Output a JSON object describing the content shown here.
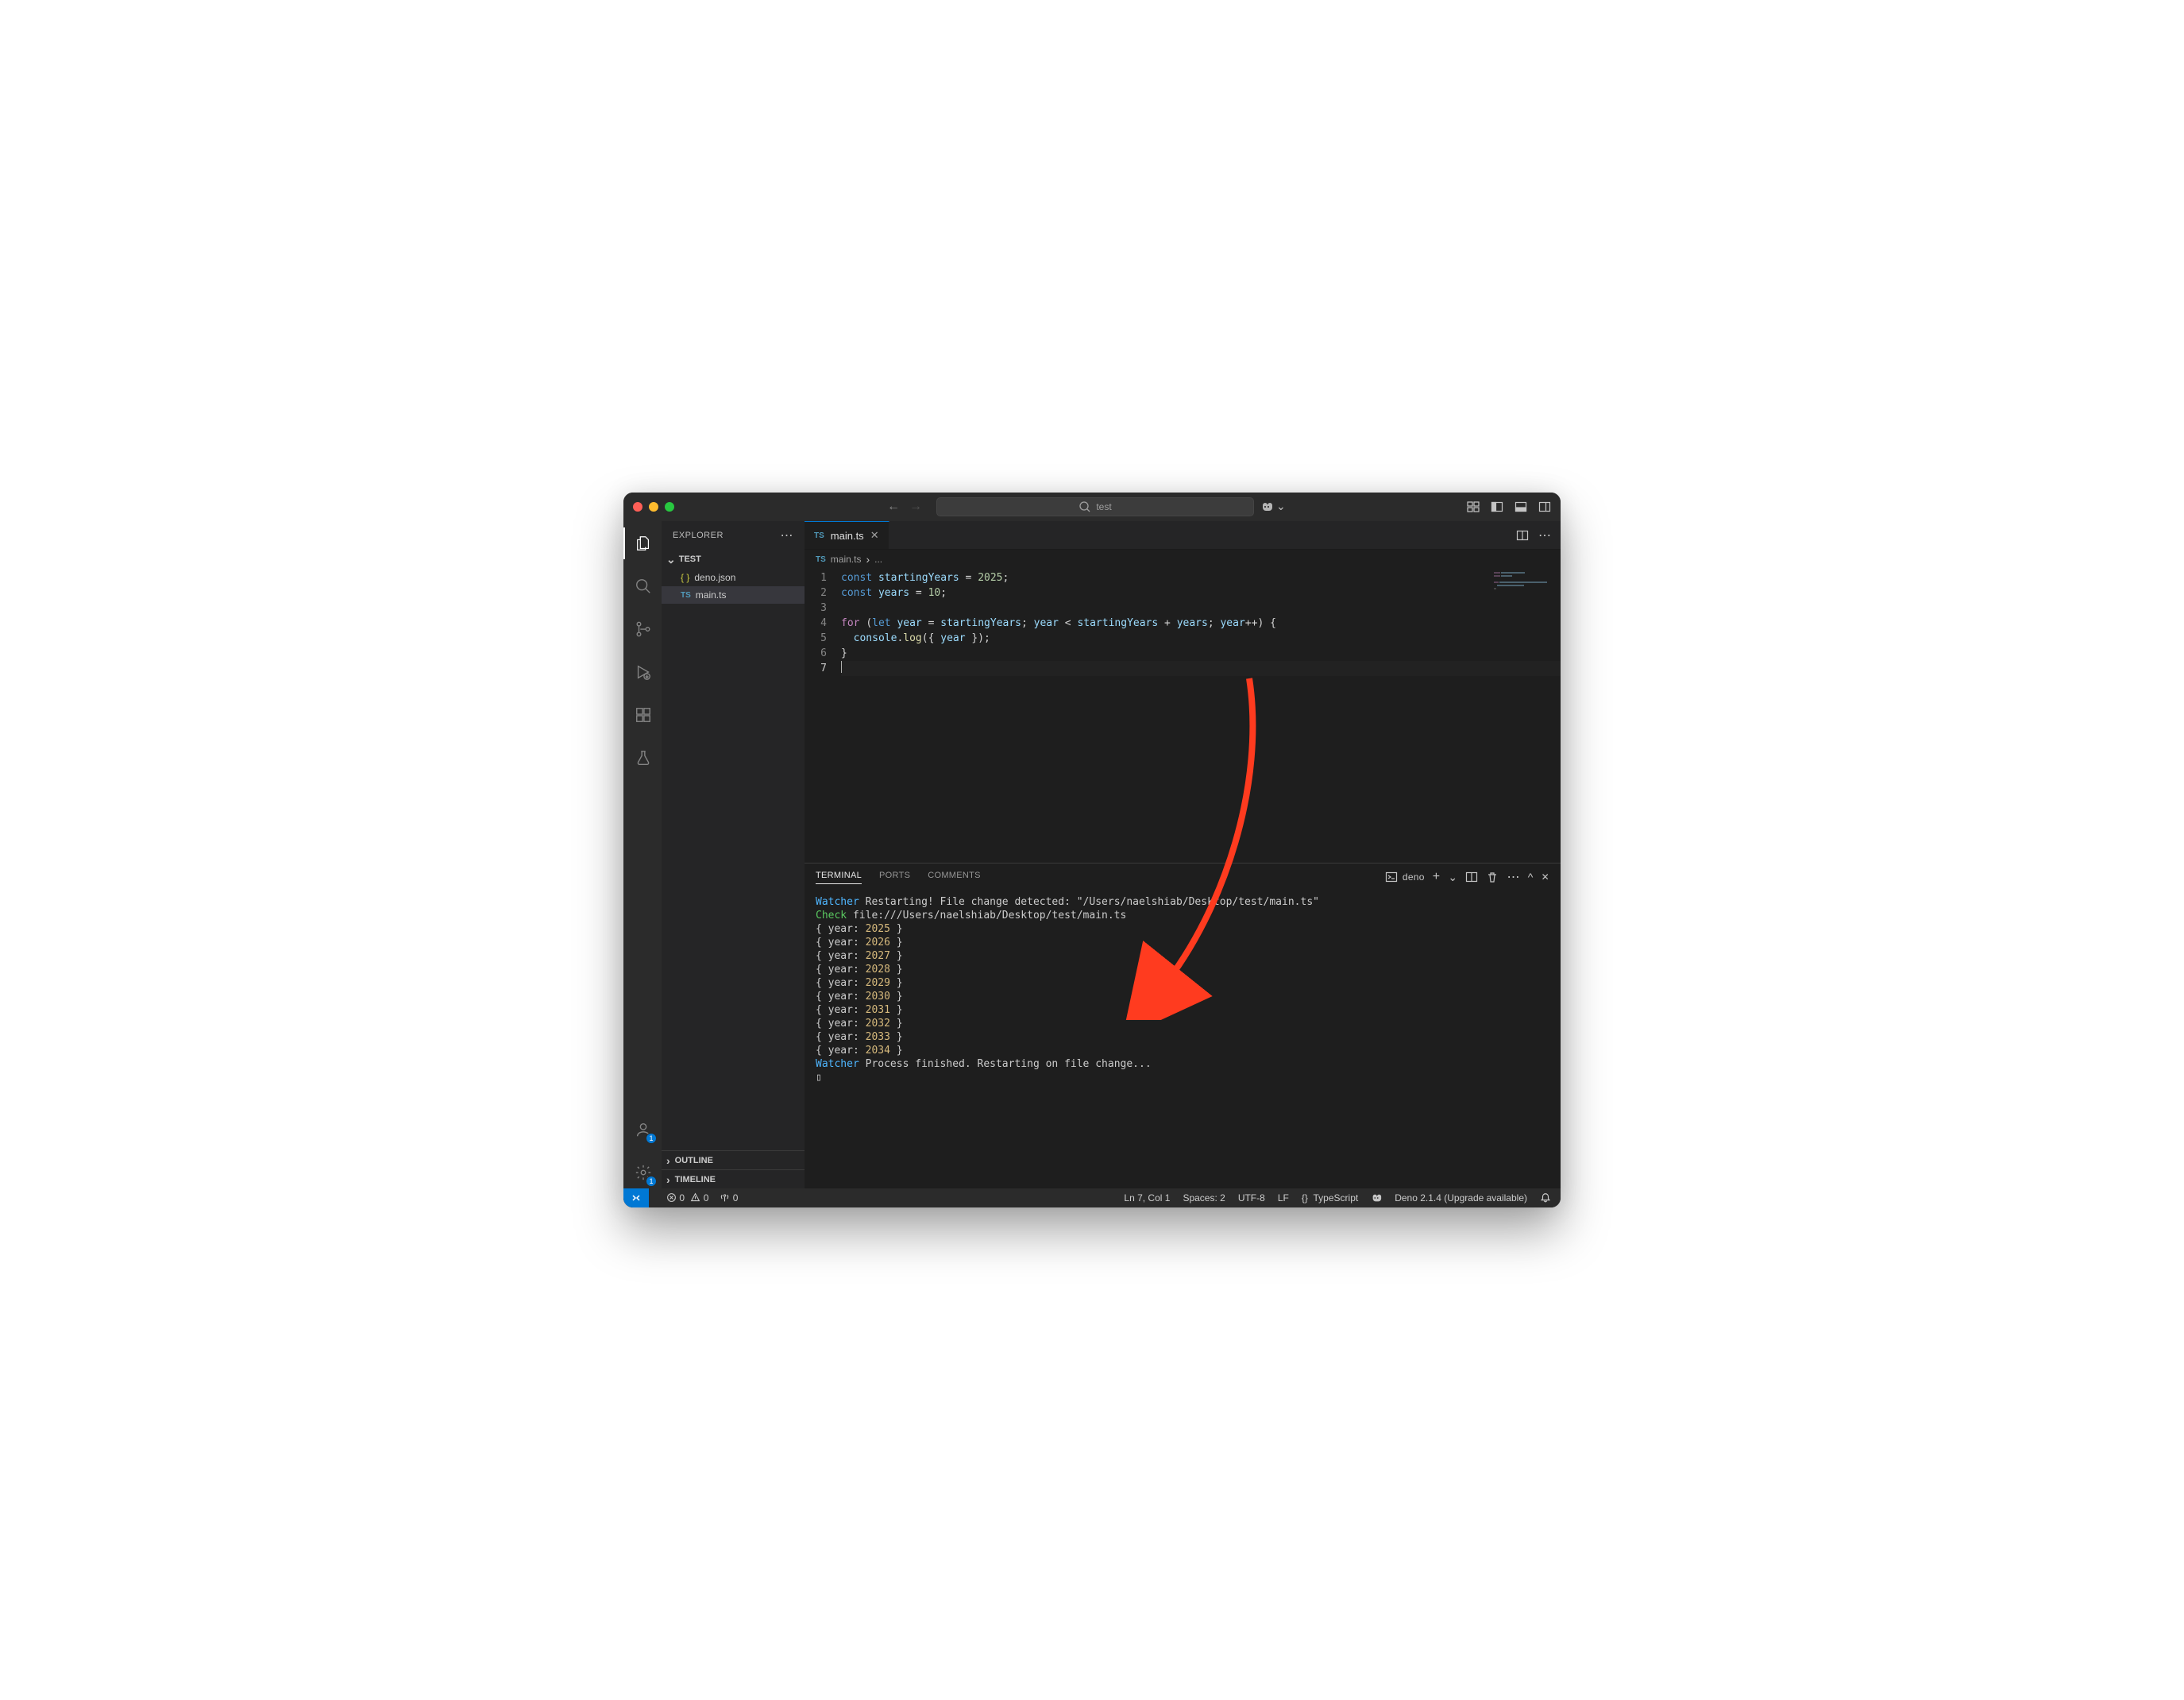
{
  "titlebar": {
    "search_text": "test"
  },
  "explorer": {
    "title": "EXPLORER",
    "root": "TEST",
    "items": [
      {
        "icon": "json",
        "label": "deno.json"
      },
      {
        "icon": "ts",
        "label": "main.ts",
        "selected": true
      }
    ],
    "outline": "OUTLINE",
    "timeline": "TIMELINE"
  },
  "tab": {
    "icon": "TS",
    "label": "main.ts"
  },
  "breadcrumb": {
    "icon": "TS",
    "file": "main.ts",
    "rest": "..."
  },
  "code": {
    "lines": [
      {
        "n": 1,
        "tokens": [
          {
            "t": "const ",
            "c": "kw2"
          },
          {
            "t": "startingYears",
            "c": "var"
          },
          {
            "t": " = ",
            "c": "op"
          },
          {
            "t": "2025",
            "c": "num"
          },
          {
            "t": ";",
            "c": "pun"
          }
        ]
      },
      {
        "n": 2,
        "tokens": [
          {
            "t": "const ",
            "c": "kw2"
          },
          {
            "t": "years",
            "c": "var"
          },
          {
            "t": " = ",
            "c": "op"
          },
          {
            "t": "10",
            "c": "num"
          },
          {
            "t": ";",
            "c": "pun"
          }
        ]
      },
      {
        "n": 3,
        "tokens": []
      },
      {
        "n": 4,
        "tokens": [
          {
            "t": "for ",
            "c": "kw"
          },
          {
            "t": "(",
            "c": "pun"
          },
          {
            "t": "let ",
            "c": "kw2"
          },
          {
            "t": "year",
            "c": "var"
          },
          {
            "t": " = ",
            "c": "op"
          },
          {
            "t": "startingYears",
            "c": "var"
          },
          {
            "t": "; ",
            "c": "pun"
          },
          {
            "t": "year",
            "c": "var"
          },
          {
            "t": " < ",
            "c": "op"
          },
          {
            "t": "startingYears",
            "c": "var"
          },
          {
            "t": " + ",
            "c": "op"
          },
          {
            "t": "years",
            "c": "var"
          },
          {
            "t": "; ",
            "c": "pun"
          },
          {
            "t": "year",
            "c": "var"
          },
          {
            "t": "++",
            "c": "op"
          },
          {
            "t": ") {",
            "c": "pun"
          }
        ]
      },
      {
        "n": 5,
        "tokens": [
          {
            "t": "  ",
            "c": "op"
          },
          {
            "t": "console",
            "c": "var"
          },
          {
            "t": ".",
            "c": "pun"
          },
          {
            "t": "log",
            "c": "fn"
          },
          {
            "t": "({ ",
            "c": "pun"
          },
          {
            "t": "year",
            "c": "var"
          },
          {
            "t": " });",
            "c": "pun"
          }
        ]
      },
      {
        "n": 6,
        "tokens": [
          {
            "t": "}",
            "c": "pun"
          }
        ]
      },
      {
        "n": 7,
        "cursor": true,
        "tokens": []
      }
    ]
  },
  "panel": {
    "tabs": {
      "terminal": "TERMINAL",
      "ports": "PORTS",
      "comments": "COMMENTS"
    },
    "shell_name": "deno"
  },
  "terminal": {
    "lines": [
      [
        {
          "t": "Watcher",
          "c": "t-blue"
        },
        {
          "t": " Restarting! File change detected: \"/Users/naelshiab/Desktop/test/main.ts\"",
          "c": ""
        }
      ],
      [
        {
          "t": "Check",
          "c": "t-green"
        },
        {
          "t": " file:///Users/naelshiab/Desktop/test/main.ts",
          "c": ""
        }
      ],
      [
        {
          "t": "{ year: ",
          "c": ""
        },
        {
          "t": "2025",
          "c": "t-yellow"
        },
        {
          "t": " }",
          "c": ""
        }
      ],
      [
        {
          "t": "{ year: ",
          "c": ""
        },
        {
          "t": "2026",
          "c": "t-yellow"
        },
        {
          "t": " }",
          "c": ""
        }
      ],
      [
        {
          "t": "{ year: ",
          "c": ""
        },
        {
          "t": "2027",
          "c": "t-yellow"
        },
        {
          "t": " }",
          "c": ""
        }
      ],
      [
        {
          "t": "{ year: ",
          "c": ""
        },
        {
          "t": "2028",
          "c": "t-yellow"
        },
        {
          "t": " }",
          "c": ""
        }
      ],
      [
        {
          "t": "{ year: ",
          "c": ""
        },
        {
          "t": "2029",
          "c": "t-yellow"
        },
        {
          "t": " }",
          "c": ""
        }
      ],
      [
        {
          "t": "{ year: ",
          "c": ""
        },
        {
          "t": "2030",
          "c": "t-yellow"
        },
        {
          "t": " }",
          "c": ""
        }
      ],
      [
        {
          "t": "{ year: ",
          "c": ""
        },
        {
          "t": "2031",
          "c": "t-yellow"
        },
        {
          "t": " }",
          "c": ""
        }
      ],
      [
        {
          "t": "{ year: ",
          "c": ""
        },
        {
          "t": "2032",
          "c": "t-yellow"
        },
        {
          "t": " }",
          "c": ""
        }
      ],
      [
        {
          "t": "{ year: ",
          "c": ""
        },
        {
          "t": "2033",
          "c": "t-yellow"
        },
        {
          "t": " }",
          "c": ""
        }
      ],
      [
        {
          "t": "{ year: ",
          "c": ""
        },
        {
          "t": "2034",
          "c": "t-yellow"
        },
        {
          "t": " }",
          "c": ""
        }
      ],
      [
        {
          "t": "Watcher",
          "c": "t-blue"
        },
        {
          "t": " Process finished. Restarting on file change...",
          "c": ""
        }
      ],
      [
        {
          "t": "▯",
          "c": ""
        }
      ]
    ]
  },
  "statusbar": {
    "errors": "0",
    "warnings": "0",
    "ports": "0",
    "lncol": "Ln 7, Col 1",
    "spaces": "Spaces: 2",
    "encoding": "UTF-8",
    "eol": "LF",
    "lang_icon": "{}",
    "lang": "TypeScript",
    "deno": "Deno 2.1.4 (Upgrade available)"
  },
  "badges": {
    "accounts": "1",
    "settings": "1"
  }
}
